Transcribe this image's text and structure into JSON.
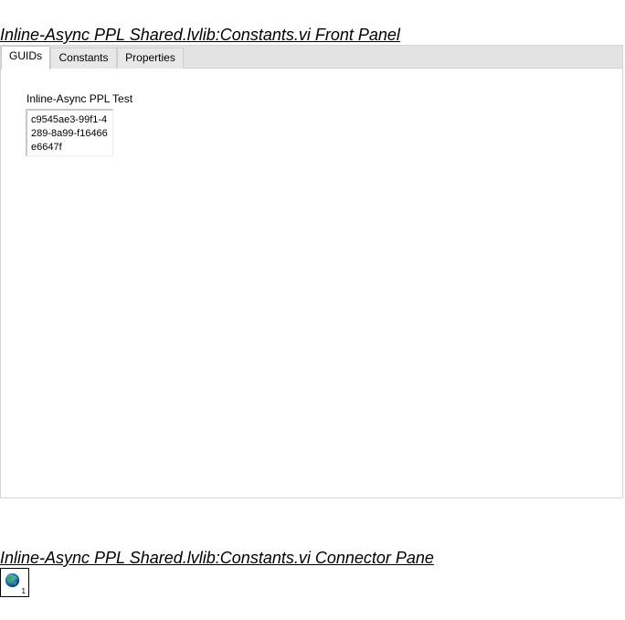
{
  "front_panel": {
    "heading": "Inline-Async PPL Shared.lvlib:Constants.vi Front Panel",
    "tabs": [
      {
        "label": "GUIDs",
        "active": true
      },
      {
        "label": "Constants",
        "active": false
      },
      {
        "label": "Properties",
        "active": false
      }
    ],
    "control": {
      "label": "Inline-Async PPL Test",
      "value": "c9545ae3-99f1-4289-8a99-f16466e6647f"
    }
  },
  "connector_pane": {
    "heading": "Inline-Async PPL Shared.lvlib:Constants.vi Connector Pane",
    "icon": "globe-icon",
    "terminal_number": "1"
  }
}
